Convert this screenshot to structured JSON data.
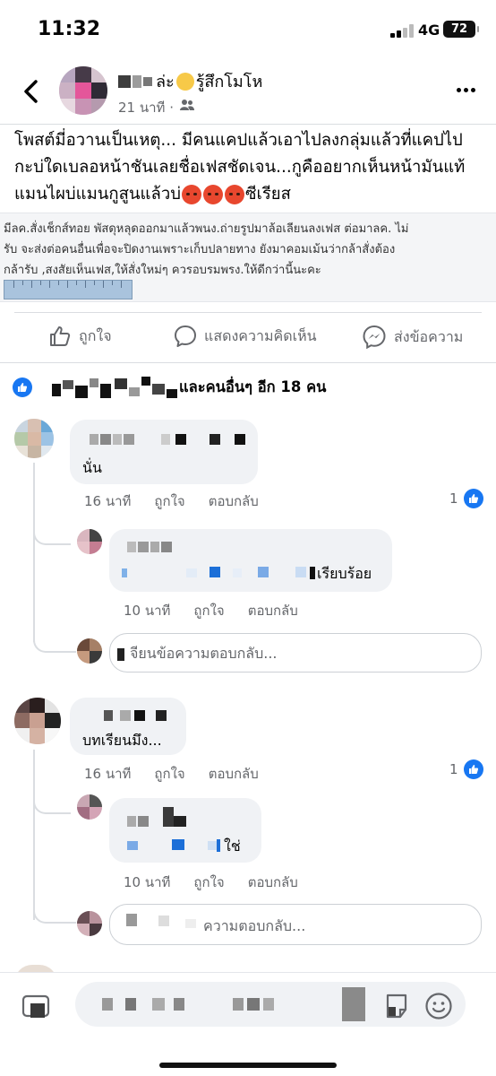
{
  "status": {
    "time": "11:32",
    "network": "4G",
    "battery": "72"
  },
  "post": {
    "author_suffix": "ล่ะ",
    "feeling": "รู้สึกโมโห",
    "time": "21 นาที ·",
    "text_line1": "โพสต์มี่อวานเป็นเหตุ... มีคนแคปแล้วเอาไปลงกลุ่มแล้วที่แคปไป",
    "text_line2": "กะบ่ใดเบลอหน้าชันเลยชื่อเฟสชัดเจน...กูคืออยากเห็นหน้ามันแท้",
    "text_line3_a": "แมนไผบ่แมนกูสูนแล้วบ่",
    "text_line3_b": "ซีเรียส",
    "screenshot_line1": "มีลค.สั่งเช็กส์ทอย พัสดุหลุดออกมาแล้วพนง.ถ่ายรูปมาล้อเลียนลงเฟส ต่อมาลค. ไม่",
    "screenshot_line2": "รับ จะส่งต่อคนอื่นเพื่อจะปิดงานเพราะเก็บปลายทาง ยังมาคอมเม้นว่ากล้าสั่งต้อง",
    "screenshot_line3": "กล้ารับ ,สงสัยเห็นเฟส,ให้สั่งใหม่ๆ ควรอบรมพรง.ให้ดีกว่านี้นะคะ"
  },
  "actions": {
    "like": "ถูกใจ",
    "comment": "แสดงความคิดเห็น",
    "share": "ส่งข้อความ"
  },
  "likers": {
    "text": "และคนอื่นๆ อีก 18 คน"
  },
  "comments": [
    {
      "text": "นั่น",
      "time": "16 นาที",
      "like": "ถูกใจ",
      "reply": "ตอบกลับ",
      "reactions": "1",
      "reply_item": {
        "text_tail": "เรียบร้อย",
        "time": "10 นาที",
        "like": "ถูกใจ",
        "reply": "ตอบกลับ"
      },
      "reply_placeholder": "จียนข้อความตอบกลับ..."
    },
    {
      "text": "บทเรียนมึง...",
      "time": "16 นาที",
      "like": "ถูกใจ",
      "reply": "ตอบกลับ",
      "reactions": "1",
      "reply_item": {
        "text_tail": "ใช่",
        "time": "10 นาที",
        "like": "ถูกใจ",
        "reply": "ตอบกลับ"
      },
      "reply_placeholder": "ความตอบกลับ..."
    }
  ],
  "colors": {
    "accent": "#1877f2",
    "muted": "#65676b",
    "bubble": "#f0f2f5",
    "divider": "#dadde1"
  }
}
